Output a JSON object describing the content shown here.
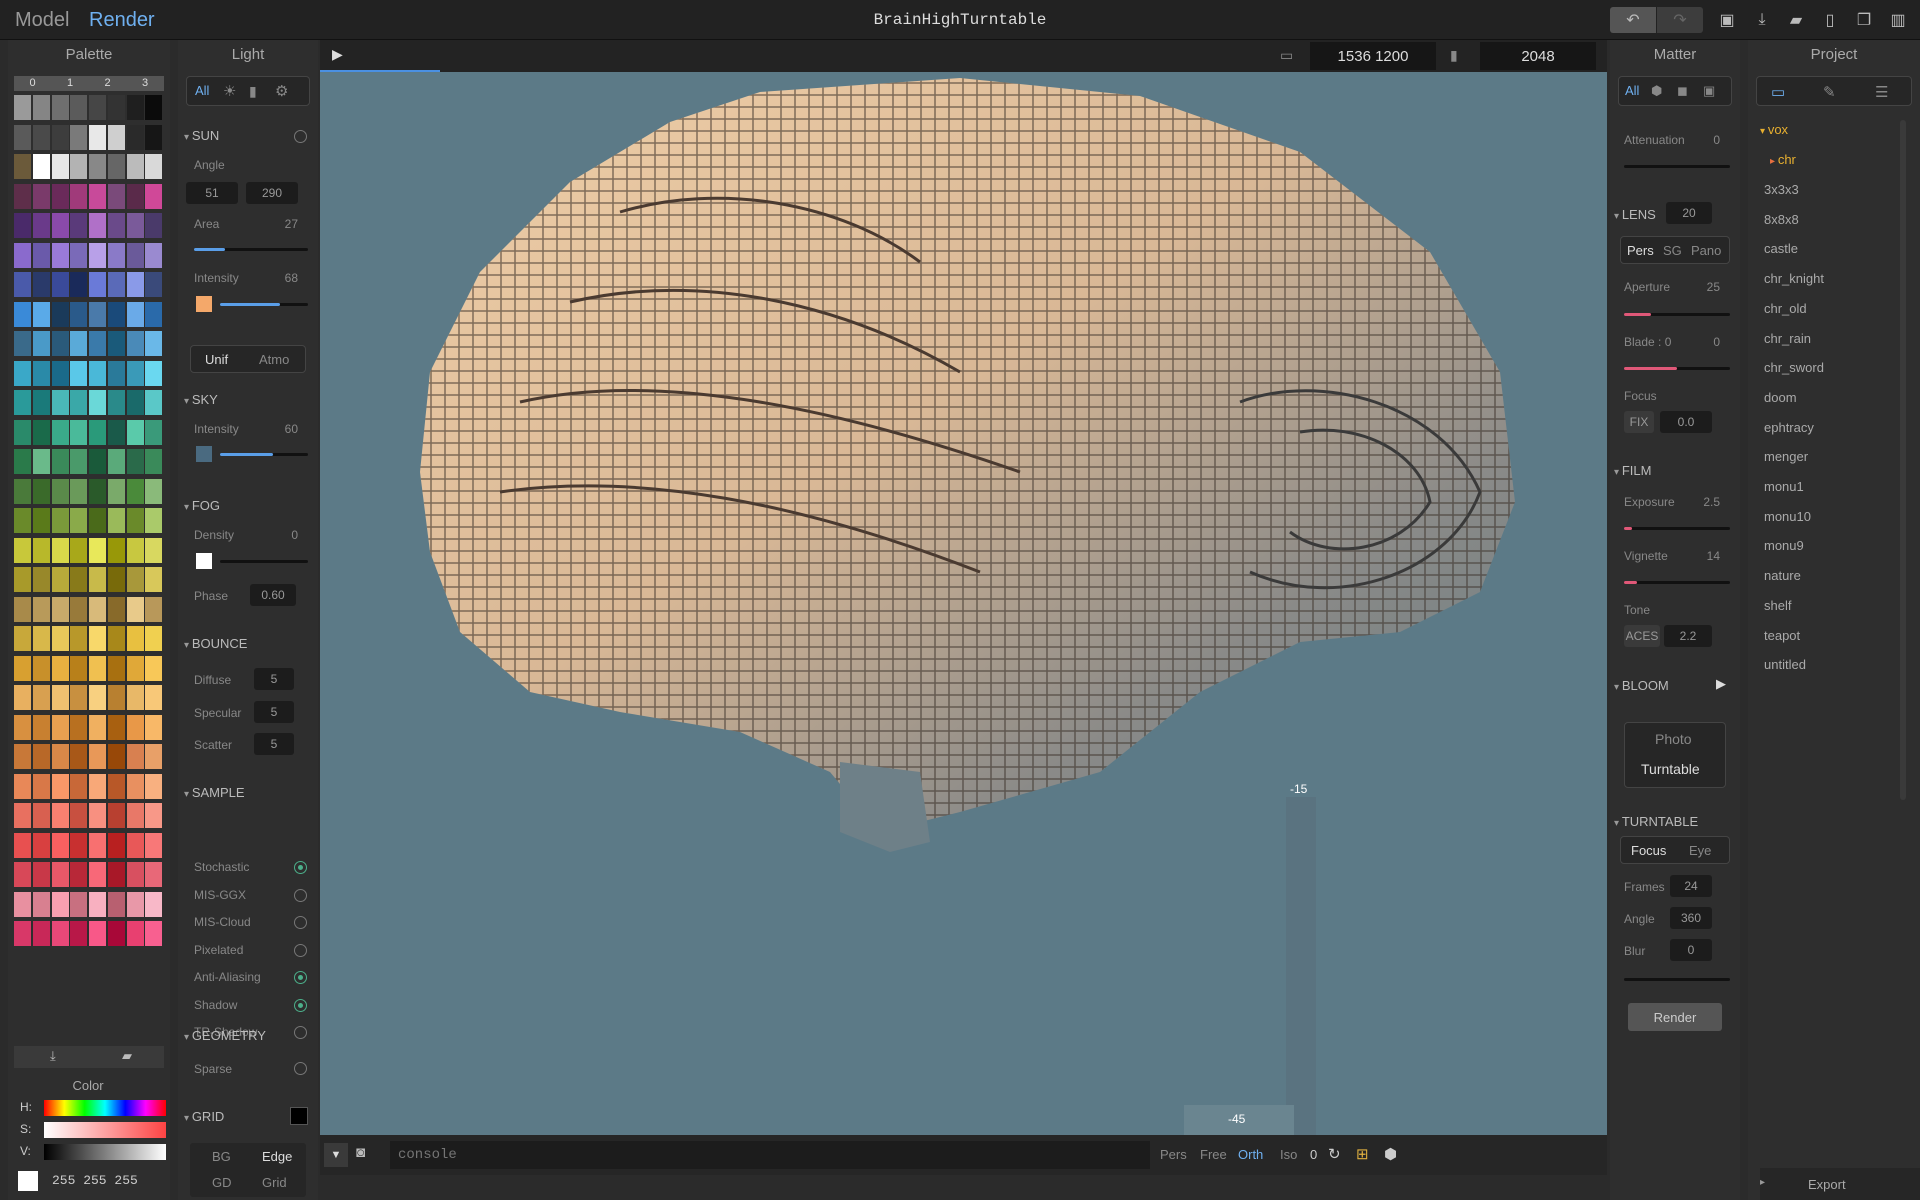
{
  "topbar": {
    "mode_model": "Model",
    "mode_render": "Render",
    "title": "BrainHighTurntable"
  },
  "palette": {
    "title": "Palette",
    "tabs": [
      "0",
      "1",
      "2",
      "3"
    ],
    "colors": [
      [
        "#9a9a9a",
        "#858585",
        "#6f6f6f",
        "#5b5b5b",
        "#464646",
        "#333",
        "#1f1f1f",
        "#0b0b0b"
      ],
      [
        "#5a5a5a",
        "#4a4a4a",
        "#3d3d3d",
        "#7a7a7a",
        "#e8e8e8",
        "#cfcfcf",
        "#2a2a2a",
        "#161616"
      ],
      [
        "#6b5a3a",
        "#ffffff",
        "#e6e6e6",
        "#b3b3b3",
        "#888",
        "#666",
        "#bbb",
        "#d9d9d9"
      ],
      [
        "#5e2e4a",
        "#7a3a6a",
        "#6a2a5a",
        "#a03a7a",
        "#c84a9a",
        "#7a4a7a",
        "#5a2a4a",
        "#d04898"
      ],
      [
        "#4a2a6a",
        "#6a3a8a",
        "#8a4aaa",
        "#5a3a7a",
        "#b070c8",
        "#6a4a8a",
        "#7a5a9a",
        "#4a3a6a"
      ],
      [
        "#8a6acd",
        "#6a5aaa",
        "#9a7ad8",
        "#7a6ab8",
        "#b8a0e8",
        "#8a7ac8",
        "#6a5a9a",
        "#9a8ad0"
      ],
      [
        "#4a5aaa",
        "#2a3a6a",
        "#3a4a9a",
        "#1a2a5a",
        "#6a7ad8",
        "#5a6ab8",
        "#8a9ae8",
        "#3a4a7a"
      ],
      [
        "#3a8ad8",
        "#5aaae8",
        "#1a3a5a",
        "#2a5a8a",
        "#4a7aaa",
        "#1a4a7a",
        "#6aaae8",
        "#2a6aaa"
      ],
      [
        "#3a6a8a",
        "#4a9ac8",
        "#2a5a7a",
        "#5aaad8",
        "#3a7aaa",
        "#1a5a7a",
        "#4a8ab8",
        "#6ab8e8"
      ],
      [
        "#3aa8c8",
        "#2a8aa8",
        "#1a6a8a",
        "#5ac8e8",
        "#4ab8d8",
        "#2a7a9a",
        "#3a9ab8",
        "#6ad8f0"
      ],
      [
        "#2a9a9a",
        "#1a7a7a",
        "#4ab8b8",
        "#3aa8a8",
        "#6ad8d8",
        "#2a8a8a",
        "#1a6a6a",
        "#5ac8c8"
      ],
      [
        "#2a8a6a",
        "#1a6a4a",
        "#3aaa8a",
        "#4aba9a",
        "#2a9a7a",
        "#1a5a4a",
        "#5acaaa",
        "#3a9a7a"
      ],
      [
        "#2a7a4a",
        "#6aba8a",
        "#3a8a5a",
        "#4a9a6a",
        "#1a5a3a",
        "#5aaa7a",
        "#2a6a4a",
        "#3a8a5a"
      ],
      [
        "#4a7a3a",
        "#3a6a2a",
        "#5a8a4a",
        "#6a9a5a",
        "#2a5a2a",
        "#7aaa6a",
        "#4a8a3a",
        "#8aba7a"
      ],
      [
        "#6a8a2a",
        "#5a7a1a",
        "#7a9a3a",
        "#8aaa4a",
        "#4a6a1a",
        "#9aba5a",
        "#6a8a2a",
        "#aaca6a"
      ],
      [
        "#c8c83a",
        "#b8b82a",
        "#d8d84a",
        "#a8a81a",
        "#e8e85a",
        "#989808",
        "#c8c840",
        "#d8d860"
      ],
      [
        "#a89a2a",
        "#98882a",
        "#b8aa3a",
        "#887a1a",
        "#c8ba4a",
        "#786a0a",
        "#a8983a",
        "#d8c85a"
      ],
      [
        "#a88a4a",
        "#b89a5a",
        "#c8aa6a",
        "#987a3a",
        "#d8ba7a",
        "#886a2a",
        "#e8ca8a",
        "#b8985a"
      ],
      [
        "#c8a83a",
        "#d8b84a",
        "#e8c85a",
        "#b8982a",
        "#f8d86a",
        "#a8881a",
        "#e8c040",
        "#f0d050"
      ],
      [
        "#d8a030",
        "#c8902a",
        "#e8b040",
        "#b8801a",
        "#f0c050",
        "#a87010",
        "#e0a838",
        "#f8c858"
      ],
      [
        "#e8b060",
        "#d8a050",
        "#f0c070",
        "#c89040",
        "#f8d080",
        "#b88030",
        "#e8b868",
        "#f8c878"
      ],
      [
        "#d89040",
        "#c88030",
        "#e8a050",
        "#b87020",
        "#f0b060",
        "#a86010",
        "#e89848",
        "#f8b868"
      ],
      [
        "#c87838",
        "#b86828",
        "#d88848",
        "#a85818",
        "#e89858",
        "#984808",
        "#d88050",
        "#e8a068"
      ],
      [
        "#e88858",
        "#d87848",
        "#f89868",
        "#c86838",
        "#f8a878",
        "#b85828",
        "#e89060",
        "#f8b080"
      ],
      [
        "#e87060",
        "#d86050",
        "#f88070",
        "#c85040",
        "#f89080",
        "#b84030",
        "#e87868",
        "#f89888"
      ],
      [
        "#e85050",
        "#d84040",
        "#f86060",
        "#c83030",
        "#f87070",
        "#b82020",
        "#e85858",
        "#f87878"
      ],
      [
        "#d84858",
        "#c83848",
        "#e85868",
        "#b82838",
        "#f86878",
        "#a81828",
        "#d85060",
        "#e86878"
      ],
      [
        "#e890a0",
        "#d88090",
        "#f8a0b0",
        "#c87080",
        "#f8b0c0",
        "#b86070",
        "#e898a8",
        "#f8b8c8"
      ],
      [
        "#d83868",
        "#c82858",
        "#e84878",
        "#b81848",
        "#f85888",
        "#a80838",
        "#e84070",
        "#f86090"
      ]
    ],
    "color_section": "Color",
    "h_label": "H:",
    "s_label": "S:",
    "v_label": "V:",
    "rgb": "255 255 255"
  },
  "light": {
    "title": "Light",
    "filter_all": "All",
    "sun": {
      "header": "SUN",
      "angle_label": "Angle",
      "angle1": "51",
      "angle2": "290",
      "area_label": "Area",
      "area_val": "27",
      "area_frac": 0.27,
      "intensity_label": "Intensity",
      "intensity_val": "68",
      "intensity_frac": 0.68,
      "color": "#f4a86a"
    },
    "mode_unif": "Unif",
    "mode_atmo": "Atmo",
    "sky": {
      "header": "SKY",
      "intensity_label": "Intensity",
      "intensity_val": "60",
      "intensity_frac": 0.6,
      "color": "#4a6a80"
    },
    "fog": {
      "header": "FOG",
      "density_label": "Density",
      "density_val": "0",
      "phase_label": "Phase",
      "phase_val": "0.60"
    },
    "bounce": {
      "header": "BOUNCE",
      "diffuse_label": "Diffuse",
      "diffuse_val": "5",
      "specular_label": "Specular",
      "specular_val": "5",
      "scatter_label": "Scatter",
      "scatter_val": "5"
    },
    "sample": {
      "header": "SAMPLE",
      "items": [
        {
          "label": "Stochastic",
          "on": true
        },
        {
          "label": "MIS-GGX",
          "on": false
        },
        {
          "label": "MIS-Cloud",
          "on": false
        },
        {
          "label": "Pixelated",
          "on": false
        },
        {
          "label": "Anti-Aliasing",
          "on": true
        },
        {
          "label": "Shadow",
          "on": true
        },
        {
          "label": "TR-Shadow",
          "on": false
        }
      ]
    },
    "geometry": {
      "header": "GEOMETRY",
      "sparse_label": "Sparse"
    },
    "grid": {
      "header": "GRID"
    },
    "bg": "BG",
    "edge": "Edge",
    "gd": "GD",
    "grid_btn": "Grid"
  },
  "viewbar": {
    "resolution": "1536  1200",
    "samples": "2048"
  },
  "viewport": {
    "ruler_v": "-15",
    "ruler_h": "-45"
  },
  "bottombar": {
    "console_placeholder": "console",
    "pers": "Pers",
    "free": "Free",
    "orth": "Orth",
    "iso": "Iso",
    "zero": "0"
  },
  "matter": {
    "title": "Matter",
    "filter_all": "All",
    "attenuation_label": "Attenuation",
    "attenuation_val": "0",
    "lens": {
      "header": "LENS",
      "val": "20",
      "pers": "Pers",
      "sg": "SG",
      "pano": "Pano",
      "aperture_label": "Aperture",
      "aperture_val": "25",
      "blade_label": "Blade : 0",
      "blade_val": "0",
      "focus_label": "Focus",
      "fix": "FIX",
      "focus_val": "0.0"
    },
    "film": {
      "header": "FILM",
      "exposure_label": "Exposure",
      "exposure_val": "2.5",
      "vignette_label": "Vignette",
      "vignette_val": "14",
      "tone_label": "Tone",
      "aces": "ACES",
      "tone_val": "2.2"
    },
    "bloom": {
      "header": "BLOOM"
    },
    "photo": "Photo",
    "turntable_btn": "Turntable",
    "turntable": {
      "header": "TURNTABLE",
      "focus": "Focus",
      "eye": "Eye",
      "frames_label": "Frames",
      "frames_val": "24",
      "angle_label": "Angle",
      "angle_val": "360",
      "blur_label": "Blur",
      "blur_val": "0"
    },
    "render_btn": "Render"
  },
  "project": {
    "title": "Project",
    "folder_vox": "vox",
    "folder_chr": "chr",
    "items": [
      "3x3x3",
      "8x8x8",
      "castle",
      "chr_knight",
      "chr_old",
      "chr_rain",
      "chr_sword",
      "doom",
      "ephtracy",
      "menger",
      "monu1",
      "monu10",
      "monu9",
      "nature",
      "shelf",
      "teapot",
      "untitled"
    ],
    "export": "Export"
  }
}
